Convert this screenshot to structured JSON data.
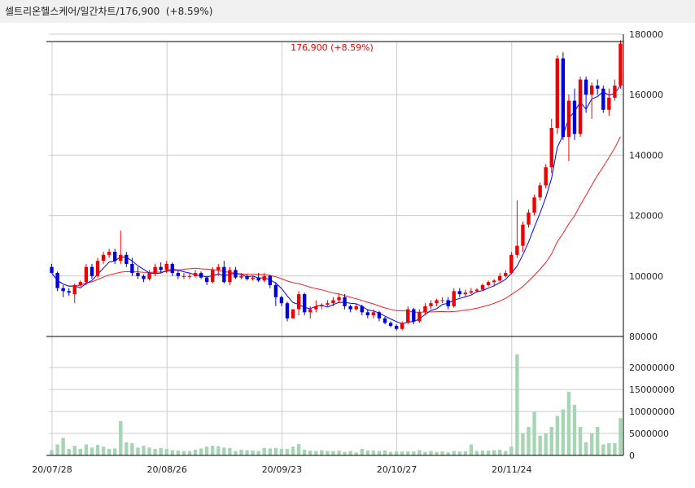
{
  "header": {
    "name": "셀트리온헬스케어",
    "period": "일간차트",
    "price": "176,900",
    "change": "(+8.59%)"
  },
  "price_label": "176,900 (+8.59%)",
  "colors": {
    "up": "#ee0000",
    "down": "#0000dd",
    "ma_short": "#0000ff",
    "ma_long": "#ee2222",
    "volume": "#a6d5b3",
    "grid": "#cccccc"
  },
  "chart_data": {
    "type": "candlestick",
    "x_tick_labels": [
      "20/07/28",
      "20/08/26",
      "20/09/23",
      "20/10/27",
      "20/11/24"
    ],
    "price_axis": {
      "ticks": [
        80000,
        100000,
        120000,
        140000,
        160000,
        180000
      ],
      "ylim": [
        80000,
        180000
      ]
    },
    "volume_axis": {
      "ticks": [
        0,
        5000000,
        10000000,
        15000000,
        20000000
      ],
      "ylim": [
        0,
        23000000
      ]
    },
    "last_price": 176900,
    "last_change_pct": 8.59,
    "ohlc": [
      [
        103000,
        104000,
        101000,
        101000
      ],
      [
        101000,
        101500,
        95000,
        96000
      ],
      [
        96000,
        97000,
        93000,
        95000
      ],
      [
        95000,
        96000,
        93500,
        94500
      ],
      [
        94000,
        97500,
        91000,
        97000
      ],
      [
        97000,
        98500,
        96500,
        98000
      ],
      [
        98000,
        104000,
        97000,
        103000
      ],
      [
        103000,
        104000,
        99000,
        100000
      ],
      [
        100000,
        106000,
        99500,
        105000
      ],
      [
        105000,
        108000,
        104000,
        107000
      ],
      [
        107000,
        109000,
        106000,
        108000
      ],
      [
        108000,
        109000,
        104000,
        105000
      ],
      [
        105000,
        115000,
        104000,
        107000
      ],
      [
        107000,
        108000,
        103000,
        104000
      ],
      [
        104000,
        106000,
        100000,
        101000
      ],
      [
        101000,
        103000,
        99000,
        100000
      ],
      [
        100000,
        100500,
        98000,
        99000
      ],
      [
        99000,
        102000,
        98500,
        101000
      ],
      [
        101000,
        104000,
        100000,
        103000
      ],
      [
        103000,
        104500,
        101000,
        102000
      ],
      [
        102000,
        105000,
        101000,
        104000
      ],
      [
        104000,
        104500,
        100000,
        101000
      ],
      [
        101000,
        102000,
        99000,
        100000
      ],
      [
        100000,
        101000,
        99000,
        100000
      ],
      [
        100000,
        101000,
        99000,
        100000
      ],
      [
        100000,
        102000,
        99500,
        101000
      ],
      [
        101000,
        101500,
        99000,
        99500
      ],
      [
        99500,
        100000,
        97000,
        98000
      ],
      [
        98000,
        103000,
        97500,
        102000
      ],
      [
        102000,
        104000,
        100000,
        103000
      ],
      [
        103000,
        105000,
        97500,
        98000
      ],
      [
        98000,
        103000,
        97000,
        102000
      ],
      [
        102000,
        103000,
        99000,
        99500
      ],
      [
        99500,
        101000,
        99000,
        100000
      ],
      [
        100000,
        100500,
        98500,
        99000
      ],
      [
        99000,
        100000,
        98500,
        99500
      ],
      [
        99500,
        101000,
        98000,
        98500
      ],
      [
        98500,
        101000,
        98000,
        100000
      ],
      [
        100000,
        100500,
        96000,
        97000
      ],
      [
        97000,
        98000,
        90000,
        93000
      ],
      [
        93000,
        93500,
        90000,
        91000
      ],
      [
        91000,
        91500,
        85000,
        86000
      ],
      [
        86000,
        89000,
        86000,
        89000
      ],
      [
        89000,
        95000,
        87000,
        94000
      ],
      [
        94000,
        94500,
        87000,
        88000
      ],
      [
        88000,
        90000,
        86000,
        89000
      ],
      [
        89000,
        92000,
        88000,
        90000
      ],
      [
        90000,
        91000,
        89000,
        90500
      ],
      [
        90500,
        92000,
        90000,
        91000
      ],
      [
        91000,
        93000,
        90000,
        92000
      ],
      [
        92000,
        94000,
        91000,
        93000
      ],
      [
        93000,
        94000,
        89000,
        90000
      ],
      [
        90000,
        90500,
        88000,
        89000
      ],
      [
        89000,
        91000,
        88500,
        90000
      ],
      [
        90000,
        90500,
        87000,
        88000
      ],
      [
        88000,
        89000,
        86000,
        87000
      ],
      [
        87000,
        89000,
        86000,
        88000
      ],
      [
        88000,
        88500,
        85000,
        86000
      ],
      [
        86000,
        86500,
        84000,
        84500
      ],
      [
        84500,
        85000,
        83000,
        83500
      ],
      [
        83500,
        84000,
        82000,
        82500
      ],
      [
        82500,
        85000,
        82000,
        84500
      ],
      [
        84500,
        90000,
        84000,
        89000
      ],
      [
        89000,
        89500,
        84000,
        85000
      ],
      [
        85000,
        89000,
        84500,
        88000
      ],
      [
        88000,
        91000,
        87000,
        90000
      ],
      [
        90000,
        92000,
        89000,
        91000
      ],
      [
        91000,
        92500,
        90000,
        92000
      ],
      [
        92000,
        93000,
        91000,
        92000
      ],
      [
        92000,
        93000,
        89000,
        90000
      ],
      [
        90000,
        96000,
        89500,
        95000
      ],
      [
        95000,
        96000,
        93000,
        94000
      ],
      [
        94000,
        95500,
        93000,
        94500
      ],
      [
        94500,
        96000,
        94000,
        95000
      ],
      [
        95000,
        96000,
        94500,
        95500
      ],
      [
        95500,
        97500,
        95000,
        97000
      ],
      [
        97000,
        98500,
        96500,
        98000
      ],
      [
        98000,
        99000,
        96500,
        98500
      ],
      [
        98500,
        101000,
        98000,
        100000
      ],
      [
        100000,
        102000,
        99500,
        101000
      ],
      [
        101000,
        108000,
        100500,
        107000
      ],
      [
        107000,
        125000,
        106000,
        110000
      ],
      [
        110000,
        118000,
        108000,
        117000
      ],
      [
        117000,
        122000,
        116000,
        121000
      ],
      [
        121000,
        127000,
        120000,
        126000
      ],
      [
        126000,
        131000,
        125000,
        130000
      ],
      [
        130000,
        137000,
        129000,
        136000
      ],
      [
        136000,
        152000,
        134000,
        149000
      ],
      [
        149000,
        173000,
        147000,
        172000
      ],
      [
        172000,
        174000,
        145000,
        146000
      ],
      [
        146000,
        160000,
        138000,
        158000
      ],
      [
        158000,
        162000,
        145000,
        147000
      ],
      [
        147000,
        166000,
        146000,
        165000
      ],
      [
        165000,
        166000,
        154000,
        160000
      ],
      [
        160000,
        164000,
        152000,
        163000
      ],
      [
        163000,
        165000,
        160000,
        162000
      ],
      [
        162000,
        163000,
        154000,
        155000
      ],
      [
        155000,
        162000,
        153000,
        159000
      ],
      [
        159000,
        165000,
        158000,
        163000
      ],
      [
        163000,
        178000,
        162000,
        176900
      ]
    ],
    "volume": [
      1200000,
      2500000,
      4000000,
      1500000,
      2200000,
      1500000,
      2500000,
      1800000,
      2400000,
      2000000,
      1500000,
      1600000,
      7800000,
      3000000,
      2800000,
      1800000,
      2200000,
      1800000,
      1500000,
      1700000,
      1500000,
      1200000,
      1100000,
      1000000,
      1000000,
      1300000,
      1600000,
      2000000,
      2200000,
      2100000,
      1800000,
      1700000,
      1000000,
      1300000,
      1200000,
      1100000,
      1000000,
      1700000,
      1600000,
      1700000,
      1500000,
      1500000,
      2000000,
      2600000,
      1300000,
      1100000,
      1000000,
      1200000,
      1000000,
      1000000,
      1100000,
      800000,
      1000000,
      700000,
      1500000,
      1100000,
      1100000,
      1000000,
      1100000,
      800000,
      900000,
      900000,
      900000,
      900000,
      1200000,
      800000,
      1000000,
      800000,
      900000,
      700000,
      1000000,
      900000,
      900000,
      2500000,
      1000000,
      1100000,
      1100000,
      1200000,
      1300000,
      1000000,
      2000000,
      23000000,
      5000000,
      6500000,
      10000000,
      4500000,
      5000000,
      6500000,
      9000000,
      10500000,
      14500000,
      11500000,
      6500000,
      3000000,
      5000000,
      6500000,
      2500000,
      2800000,
      2800000,
      8500000
    ]
  }
}
